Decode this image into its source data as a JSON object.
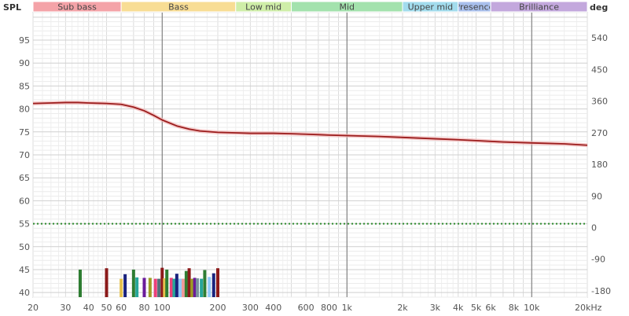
{
  "chart_data": {
    "type": "line",
    "left_axis_title": "SPL",
    "right_axis_title": "deg",
    "x_scale": "log",
    "x_range": [
      20,
      20000
    ],
    "y_range": [
      39,
      101
    ],
    "y_right_range": [
      -198,
      612
    ],
    "x_tick_labels": [
      {
        "v": 20,
        "label": "20"
      },
      {
        "v": 30,
        "label": "30"
      },
      {
        "v": 40,
        "label": "40"
      },
      {
        "v": 50,
        "label": "50"
      },
      {
        "v": 60,
        "label": "60"
      },
      {
        "v": 80,
        "label": "80"
      },
      {
        "v": 100,
        "label": "100"
      },
      {
        "v": 200,
        "label": "200"
      },
      {
        "v": 300,
        "label": "300"
      },
      {
        "v": 400,
        "label": "400"
      },
      {
        "v": 600,
        "label": "600"
      },
      {
        "v": 800,
        "label": "800"
      },
      {
        "v": 1000,
        "label": "1k"
      },
      {
        "v": 2000,
        "label": "2k"
      },
      {
        "v": 3000,
        "label": "3k"
      },
      {
        "v": 4000,
        "label": "4k"
      },
      {
        "v": 5000,
        "label": "5k"
      },
      {
        "v": 6000,
        "label": "6k"
      },
      {
        "v": 8000,
        "label": "8k"
      },
      {
        "v": 10000,
        "label": "10k"
      },
      {
        "v": 20000,
        "label": "20kHz"
      }
    ],
    "y_ticks": [
      40,
      45,
      50,
      55,
      60,
      65,
      70,
      75,
      80,
      85,
      90,
      95
    ],
    "y_right_ticks": [
      -180,
      -90,
      0,
      90,
      180,
      270,
      360,
      450,
      540
    ],
    "grid": true,
    "bands": [
      {
        "label": "Sub bass",
        "from": 20,
        "to": 60,
        "color": "#f4a3a8"
      },
      {
        "label": "Bass",
        "from": 60,
        "to": 250,
        "color": "#f8dd94"
      },
      {
        "label": "Low mid",
        "from": 250,
        "to": 500,
        "color": "#cfeea8"
      },
      {
        "label": "Mid",
        "from": 500,
        "to": 2000,
        "color": "#a3e2ad"
      },
      {
        "label": "Upper mid",
        "from": 2000,
        "to": 4000,
        "color": "#a2dced"
      },
      {
        "label": "Presence",
        "from": 4000,
        "to": 6000,
        "color": "#a8bfec"
      },
      {
        "label": "Brilliance",
        "from": 6000,
        "to": 20000,
        "color": "#c3a8dd"
      }
    ],
    "series": [
      {
        "color": "#9b1c1c",
        "points": [
          [
            20,
            81.2
          ],
          [
            25,
            81.3
          ],
          [
            30,
            81.4
          ],
          [
            35,
            81.4
          ],
          [
            40,
            81.3
          ],
          [
            50,
            81.2
          ],
          [
            60,
            81.0
          ],
          [
            70,
            80.4
          ],
          [
            80,
            79.6
          ],
          [
            90,
            78.6
          ],
          [
            100,
            77.6
          ],
          [
            120,
            76.3
          ],
          [
            140,
            75.6
          ],
          [
            160,
            75.2
          ],
          [
            200,
            74.9
          ],
          [
            250,
            74.8
          ],
          [
            300,
            74.7
          ],
          [
            350,
            74.7
          ],
          [
            400,
            74.7
          ],
          [
            500,
            74.6
          ],
          [
            600,
            74.5
          ],
          [
            700,
            74.4
          ],
          [
            800,
            74.3
          ],
          [
            1000,
            74.2
          ],
          [
            1500,
            74.0
          ],
          [
            2000,
            73.8
          ],
          [
            3000,
            73.5
          ],
          [
            4000,
            73.3
          ],
          [
            5000,
            73.1
          ],
          [
            7000,
            72.8
          ],
          [
            10000,
            72.6
          ],
          [
            15000,
            72.4
          ],
          [
            20000,
            72.1
          ]
        ]
      },
      {
        "color": "#2e8b2e",
        "style": "dotted",
        "points": [
          [
            20,
            55
          ],
          [
            20000,
            55
          ]
        ]
      }
    ],
    "marker_lines_hz": [
      100,
      1000,
      10000
    ],
    "bars_note": "multi-colored bars near bottom, values in dB",
    "bars": [
      {
        "x": 36,
        "v": 45.0,
        "c": "#2e7d32"
      },
      {
        "x": 50,
        "v": 45.3,
        "c": "#8b1a1a"
      },
      {
        "x": 60,
        "v": 43.0,
        "c": "#e6c24d"
      },
      {
        "x": 63,
        "v": 44.0,
        "c": "#1a237e"
      },
      {
        "x": 70,
        "v": 45.0,
        "c": "#2e7d32"
      },
      {
        "x": 73,
        "v": 43.3,
        "c": "#26a69a"
      },
      {
        "x": 80,
        "v": 43.2,
        "c": "#6a1b9a"
      },
      {
        "x": 86,
        "v": 43.2,
        "c": "#9e9d24"
      },
      {
        "x": 92,
        "v": 43.0,
        "c": "#ec407a"
      },
      {
        "x": 96,
        "v": 43.0,
        "c": "#546e7a"
      },
      {
        "x": 100,
        "v": 45.4,
        "c": "#8b1a1a"
      },
      {
        "x": 103,
        "v": 43.1,
        "c": "#e6c24d"
      },
      {
        "x": 106,
        "v": 45.0,
        "c": "#2e7d32"
      },
      {
        "x": 112,
        "v": 43.2,
        "c": "#ec407a"
      },
      {
        "x": 116,
        "v": 43.0,
        "c": "#26a69a"
      },
      {
        "x": 120,
        "v": 44.1,
        "c": "#1a237e"
      },
      {
        "x": 125,
        "v": 43.0,
        "c": "#90caf9"
      },
      {
        "x": 130,
        "v": 43.0,
        "c": "#ef9a9a"
      },
      {
        "x": 135,
        "v": 44.7,
        "c": "#2e7d32"
      },
      {
        "x": 140,
        "v": 45.3,
        "c": "#8b1a1a"
      },
      {
        "x": 145,
        "v": 43.0,
        "c": "#9e9d24"
      },
      {
        "x": 150,
        "v": 43.2,
        "c": "#6a1b9a"
      },
      {
        "x": 155,
        "v": 43.1,
        "c": "#78909c"
      },
      {
        "x": 163,
        "v": 43.0,
        "c": "#26a69a"
      },
      {
        "x": 170,
        "v": 44.9,
        "c": "#2e7d32"
      },
      {
        "x": 180,
        "v": 43.4,
        "c": "#90caf9"
      },
      {
        "x": 190,
        "v": 44.2,
        "c": "#1a237e"
      },
      {
        "x": 200,
        "v": 45.3,
        "c": "#8b1a1a"
      }
    ]
  }
}
